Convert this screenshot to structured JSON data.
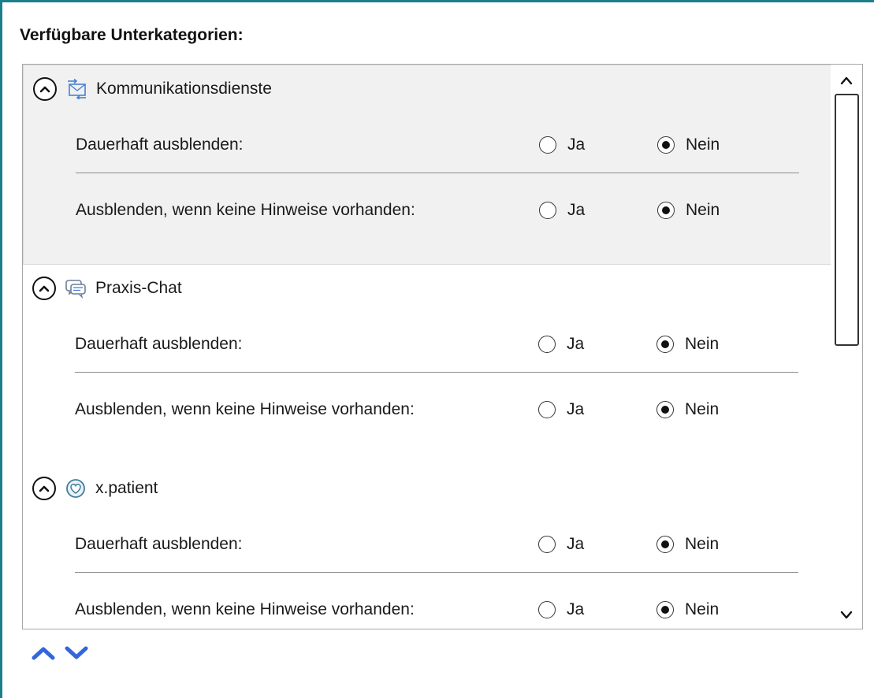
{
  "panel": {
    "title": "Verfügbare Unterkategorien:"
  },
  "categories": [
    {
      "label": "Kommunikationsdienste",
      "icon": "mail-sync-icon",
      "selected": true,
      "options": [
        {
          "label": "Dauerhaft ausblenden:",
          "ja": "Ja",
          "nein": "Nein",
          "value": "nein"
        },
        {
          "label": "Ausblenden, wenn keine Hinweise vorhanden:",
          "ja": "Ja",
          "nein": "Nein",
          "value": "nein"
        }
      ]
    },
    {
      "label": "Praxis-Chat",
      "icon": "chat-icon",
      "selected": false,
      "options": [
        {
          "label": "Dauerhaft ausblenden:",
          "ja": "Ja",
          "nein": "Nein",
          "value": "nein"
        },
        {
          "label": "Ausblenden, wenn keine Hinweise vorhanden:",
          "ja": "Ja",
          "nein": "Nein",
          "value": "nein"
        }
      ]
    },
    {
      "label": "x.patient",
      "icon": "heart-icon",
      "selected": false,
      "options": [
        {
          "label": "Dauerhaft ausblenden:",
          "ja": "Ja",
          "nein": "Nein",
          "value": "nein"
        },
        {
          "label": "Ausblenden, wenn keine Hinweise vorhanden:",
          "ja": "Ja",
          "nein": "Nein",
          "value": "nein"
        }
      ]
    }
  ],
  "colors": {
    "frame": "#1b7e8c",
    "accent_blue": "#3366dd",
    "icon_blue": "#4a7fd6"
  },
  "icons": {
    "collapse": "chevron-up-circle-icon",
    "scroll_up": "chevron-up-icon",
    "scroll_down": "chevron-down-icon",
    "move_up": "arrow-up-icon",
    "move_down": "arrow-down-icon"
  }
}
